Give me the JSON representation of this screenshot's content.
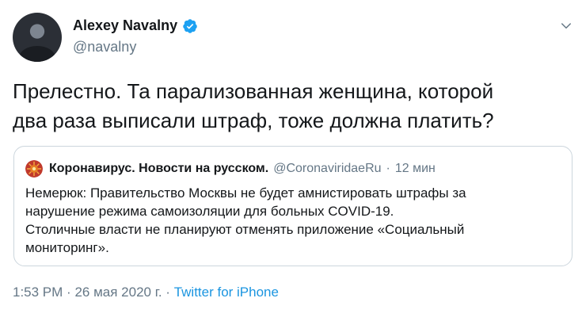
{
  "author": {
    "name": "Alexey Navalny",
    "handle": "@navalny",
    "verified": true,
    "verified_color": "#1da1f2"
  },
  "tweet": {
    "lines": [
      "Прелестно. Та парализованная женщина, которой",
      "два раза выписали штраф, тоже должна платить?"
    ]
  },
  "quoted": {
    "name": "Коронавирус. Новости на русском.",
    "handle": "@CoronaviridaeRu",
    "separator": "·",
    "time": "12 мин",
    "lines": [
      "Немерюк: Правительство Москвы не будет амнистировать штрафы за",
      "нарушение режима самоизоляции для больных COVID-19.",
      "Столичные власти не планируют отменять приложение «Социальный",
      "мониторинг»."
    ]
  },
  "meta": {
    "time": "1:53 PM",
    "date": "26 мая 2020 г.",
    "separator": "·",
    "source": "Twitter for iPhone",
    "link_color": "#1b95e0"
  },
  "icons": {
    "menu": "chevron-down-icon",
    "verified": "verified-badge-icon"
  }
}
